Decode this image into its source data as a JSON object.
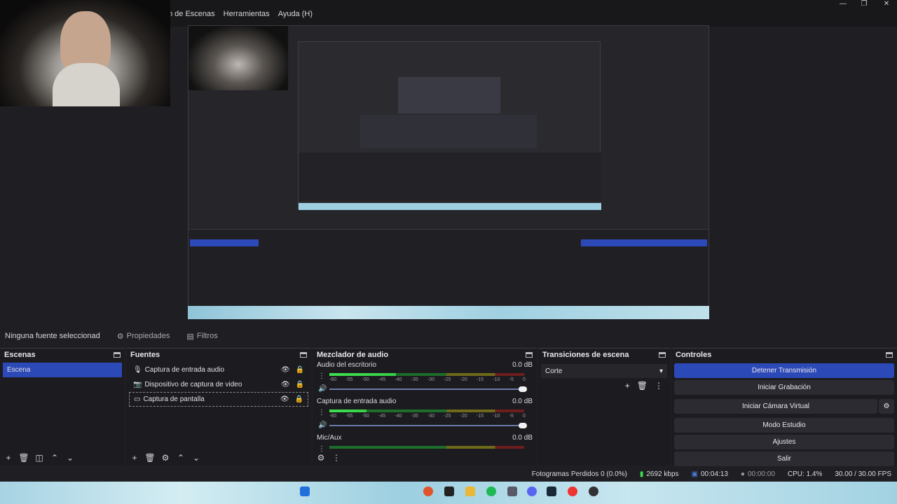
{
  "menu": [
    "n de Escenas",
    "Herramientas",
    "Ayuda (H)"
  ],
  "window_controls": [
    "—",
    "❐",
    "✕"
  ],
  "source_bar": {
    "selected": "Ninguna fuente seleccionad",
    "properties": "Propiedades",
    "filters": "Filtros"
  },
  "scenes": {
    "title": "Escenas",
    "items": [
      "Escena"
    ]
  },
  "sources": {
    "title": "Fuentes",
    "items": [
      "Captura de entrada audio",
      "Dispositivo de captura de video",
      "Captura de pantalla"
    ]
  },
  "mixer": {
    "title": "Mezclador de audio",
    "ticks": [
      "-60",
      "-55",
      "-50",
      "-45",
      "-40",
      "-35",
      "-30",
      "-25",
      "-20",
      "-15",
      "-10",
      "-5",
      "0"
    ],
    "channels": [
      {
        "name": "Audio del escritorio",
        "db": "0.0 dB",
        "level": 0.34
      },
      {
        "name": "Captura de entrada audio",
        "db": "0.0 dB",
        "level": 0.19
      },
      {
        "name": "Mic/Aux",
        "db": "0.0 dB",
        "level": 0.0
      }
    ]
  },
  "transitions": {
    "title": "Transiciones de escena",
    "selected": "Corte"
  },
  "controls": {
    "title": "Controles",
    "buttons": [
      "Detener Transmisión",
      "Iniciar Grabación",
      "Iniciar Cámara Virtual",
      "Modo Estudio",
      "Ajustes",
      "Salir"
    ]
  },
  "status": {
    "dropped": "Fotogramas Perdidos 0 (0.0%)",
    "bitrate": "2692 kbps",
    "stream_time": "00:04:13",
    "rec_time": "00:00:00",
    "cpu": "CPU: 1.4%",
    "fps": "30.00 / 30.00 FPS"
  },
  "colors": {
    "accent": "#2c49b8",
    "panel": "#1c1c20",
    "meter_green": "#3ee04f"
  }
}
